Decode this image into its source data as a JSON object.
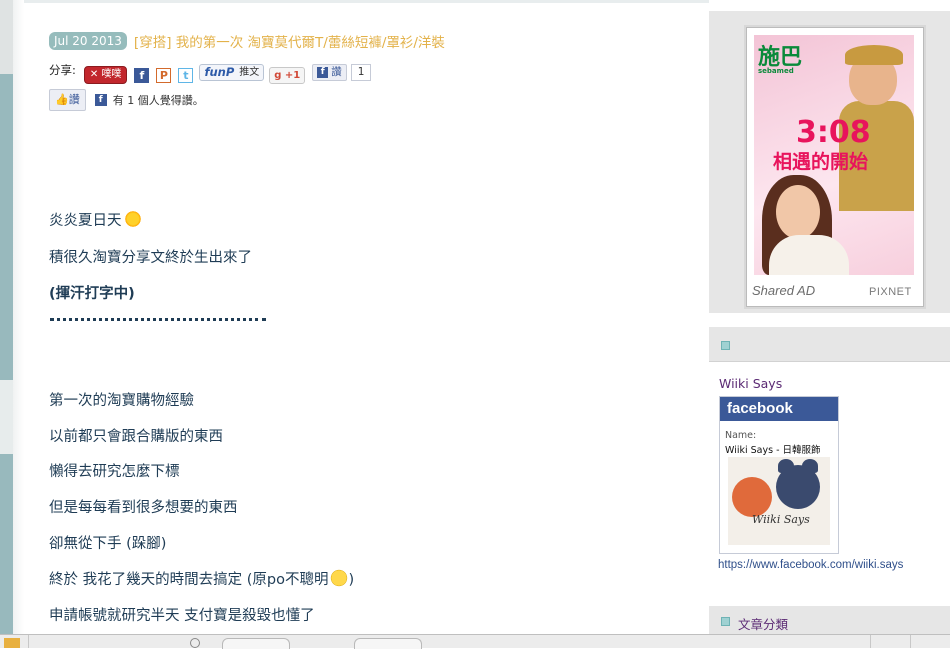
{
  "post": {
    "date": "Jul 20 2013",
    "title": "[穿搭] 我的第一次 淘寶莫代爾T/蕾絲短褲/罩衫/洋裝"
  },
  "share": {
    "label": "分享:",
    "plurk_label": "噗噗",
    "facebook_icon": "f",
    "plurk_icon": "P",
    "twitter_icon": "t",
    "funp_logo": "funP",
    "funp_label": "推文",
    "gplus_label": "+1",
    "fb_like_label": "讚",
    "fb_like_count": "1"
  },
  "like": {
    "button_label": "讚",
    "summary": "有 1 個人覺得讚。"
  },
  "content": {
    "lines": [
      "炎炎夏日天",
      "積很久淘寶分享文終於生出來了",
      "(揮汗打字中)",
      "第一次的淘寶購物經驗",
      "以前都只會跟合購版的東西",
      "懶得去研究怎麼下標",
      "但是每每看到很多想要的東西",
      "卻無從下手 (跺腳)",
      "終於 我花了幾天的時間去搞定 (原po不聰明",
      ")",
      "申請帳號就研究半天 支付寶是殺毀也懂了"
    ]
  },
  "sidebar": {
    "ad": {
      "brand": "施巴",
      "brand_sub": "sebamed",
      "headline": "3:08",
      "subhead": "相遇的開始",
      "shared_label": "Shared AD",
      "network_label": "PIXNET"
    },
    "fan_widget": {
      "title": "Wiiki Says",
      "fb_header": "facebook",
      "name_label": "Name:",
      "name_value": "Wiiki Says - 日韓服飾",
      "signature": "Wiiki Says",
      "url": "https://www.facebook.com/wiiki.says"
    },
    "category_title": "文章分類"
  },
  "colors": {
    "accent_teal": "#96bcbc",
    "title_gold": "#e3b24a",
    "body_text": "#1f3c55",
    "facebook_blue": "#3b5998",
    "sidebar_purple": "#5b2a74"
  }
}
